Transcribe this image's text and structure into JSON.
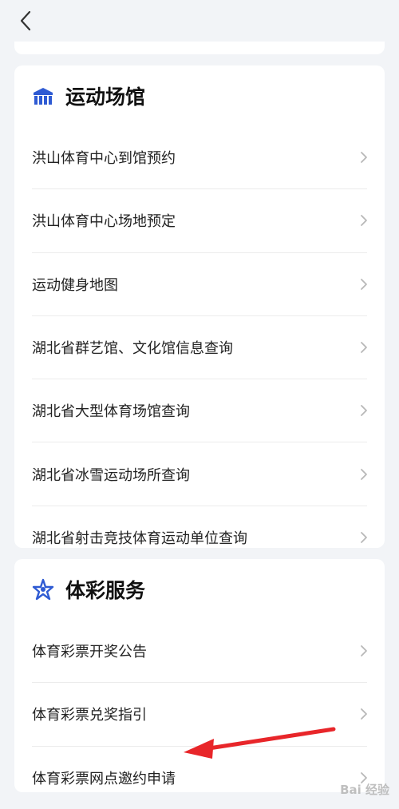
{
  "nav": {
    "back_icon": "chevron-left-icon"
  },
  "sections": {
    "venues": {
      "title": "运动场馆",
      "icon": "stadium-icon",
      "icon_color": "#2f5bd3",
      "items": [
        "洪山体育中心到馆预约",
        "洪山体育中心场地预定",
        "运动健身地图",
        "湖北省群艺馆、文化馆信息查询",
        "湖北省大型体育场馆查询",
        "湖北省冰雪运动场所查询",
        "湖北省射击竞技体育运动单位查询"
      ]
    },
    "lottery": {
      "title": "体彩服务",
      "icon": "lottery-star-icon",
      "icon_color": "#2f5bd3",
      "items": [
        "体育彩票开奖公告",
        "体育彩票兑奖指引",
        "体育彩票网点邀约申请"
      ]
    }
  },
  "annotation": {
    "arrow_color": "#e8262a"
  },
  "watermark": {
    "text": "Bai 经验"
  }
}
